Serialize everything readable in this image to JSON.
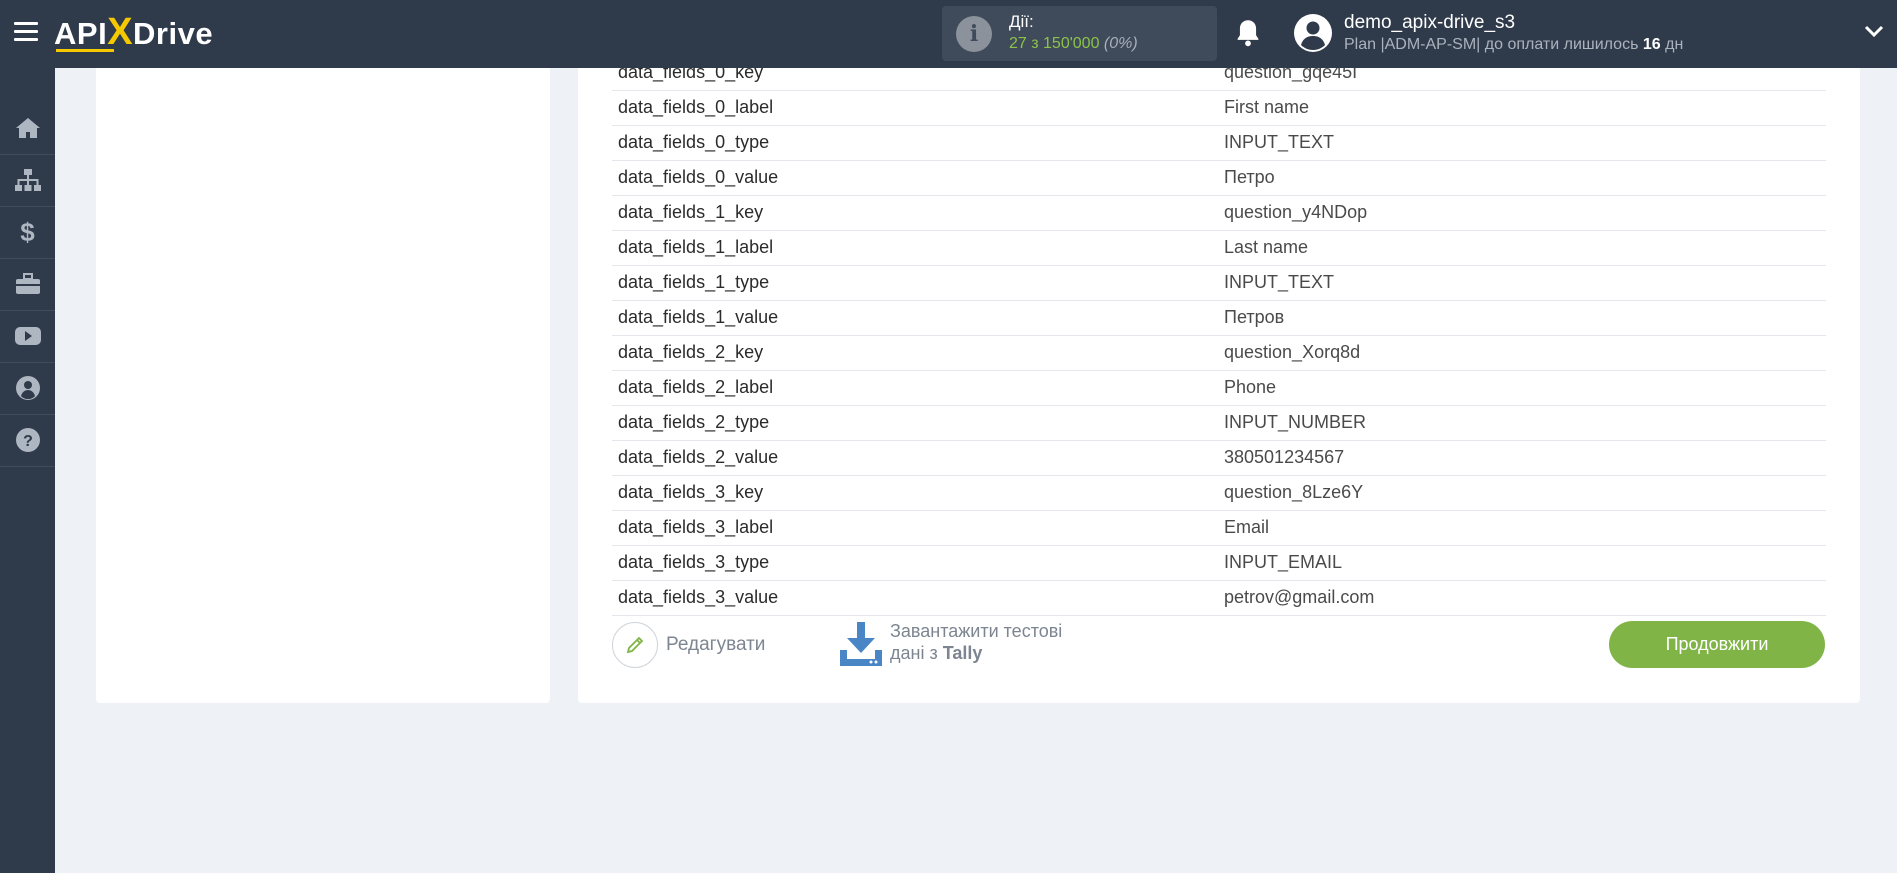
{
  "app": {
    "logo_left": "API",
    "logo_x": "X",
    "logo_right": "Drive"
  },
  "actions": {
    "label": "Дії:",
    "count": "27 з 150'000",
    "percent": "(0%)"
  },
  "user": {
    "name": "demo_apix-drive_s3",
    "plan_prefix": "Plan |ADM-AP-SM| до оплати лишилось ",
    "days": "16",
    "days_unit": " дн"
  },
  "sidebar": {
    "items": [
      "home-icon",
      "sitemap-icon",
      "dollar-icon",
      "briefcase-icon",
      "youtube-icon",
      "user-icon",
      "help-icon"
    ]
  },
  "fields": [
    {
      "key": "data_fields_0_key",
      "value": "question_gqe45I"
    },
    {
      "key": "data_fields_0_label",
      "value": "First name"
    },
    {
      "key": "data_fields_0_type",
      "value": "INPUT_TEXT"
    },
    {
      "key": "data_fields_0_value",
      "value": "Петро"
    },
    {
      "key": "data_fields_1_key",
      "value": "question_y4NDop"
    },
    {
      "key": "data_fields_1_label",
      "value": "Last name"
    },
    {
      "key": "data_fields_1_type",
      "value": "INPUT_TEXT"
    },
    {
      "key": "data_fields_1_value",
      "value": "Петров"
    },
    {
      "key": "data_fields_2_key",
      "value": "question_Xorq8d"
    },
    {
      "key": "data_fields_2_label",
      "value": "Phone"
    },
    {
      "key": "data_fields_2_type",
      "value": "INPUT_NUMBER"
    },
    {
      "key": "data_fields_2_value",
      "value": "380501234567"
    },
    {
      "key": "data_fields_3_key",
      "value": "question_8Lze6Y"
    },
    {
      "key": "data_fields_3_label",
      "value": "Email"
    },
    {
      "key": "data_fields_3_type",
      "value": "INPUT_EMAIL"
    },
    {
      "key": "data_fields_3_value",
      "value": "petrov@gmail.com"
    }
  ],
  "buttons": {
    "edit": "Редагувати",
    "download_line1": "Завантажити тестові",
    "download_line2": "дані з ",
    "download_source": "Tally",
    "continue": "Продовжити"
  },
  "colors": {
    "accent": "#80b447",
    "sidebar": "#2f3a4a",
    "download_icon": "#4a86c5"
  }
}
